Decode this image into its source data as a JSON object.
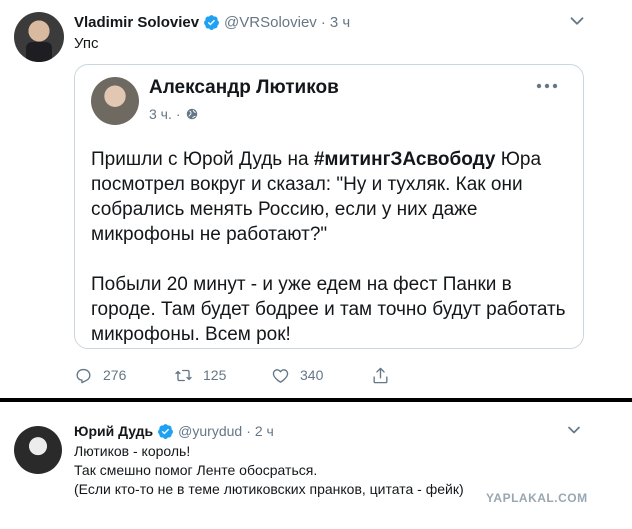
{
  "tweet1": {
    "author_name": "Vladimir Soloviev",
    "handle": "@VRSoloviev",
    "dot": "·",
    "time": "3 ч",
    "text": "Упс",
    "quote": {
      "author_name": "Александр Лютиков",
      "time": "3 ч.",
      "dot": "·",
      "line1_pre": "Пришли с Юрой Дудь на ",
      "line1_tag": "#митингЗАсвободу",
      "line1_post": " Юра посмотрел вокруг и сказал: \"Ну и тухляк. Как они собрались менять Россию, если у них даже микрофоны не работают?\"",
      "paragraph2": "Побыли 20 минут - и уже едем на фест Панки в городе. Там будет бодрее и там точно будут работать микрофоны. Всем рок!"
    },
    "actions": {
      "replies": "276",
      "retweets": "125",
      "likes": "340"
    }
  },
  "tweet2": {
    "author_name": "Юрий Дудь",
    "handle": "@yurydud",
    "dot": "·",
    "time": "2 ч",
    "line1": "Лютиков - король!",
    "line2": "Так смешно помог Ленте обосраться.",
    "line3": "(Если кто-то не в теме лютиковских пранков, цитата - фейк)"
  },
  "watermark": "YAPLAKAL.COM",
  "colors": {
    "verified": "#1da1f2",
    "secondary_text": "#657786",
    "border": "#ccd6dd"
  }
}
